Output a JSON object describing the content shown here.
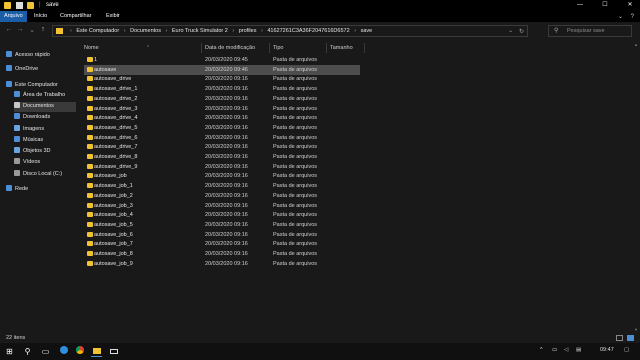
{
  "window": {
    "title": "save",
    "minimize": "—",
    "maximize": "☐",
    "close": "✕"
  },
  "ribbon": {
    "tabs": [
      {
        "label": "Arquivo",
        "active": true
      },
      {
        "label": "Início",
        "active": false
      },
      {
        "label": "Compartilhar",
        "active": false
      },
      {
        "label": "Exibir",
        "active": false
      }
    ],
    "collapse": "⌄",
    "help": "?"
  },
  "nav": {
    "back": "←",
    "forward": "→",
    "recent": "⌄",
    "up": "↑"
  },
  "address": {
    "crumbs": [
      "Este Computador",
      "Documentos",
      "Euro Truck Simulator 2",
      "profiles",
      "41627261C3A36F2047616D6572",
      "save"
    ],
    "separator": "›",
    "dropdown": "⌄",
    "refresh": "↻"
  },
  "search": {
    "placeholder": "Pesquisar save",
    "icon": "search-icon"
  },
  "sidebar": {
    "items": [
      {
        "label": "Acesso rápido",
        "icon": "star-icon",
        "color": "#4d8fd6"
      },
      {
        "label": "OneDrive",
        "icon": "cloud-icon",
        "color": "#4d8fd6"
      },
      {
        "label": "Este Computador",
        "icon": "computer-icon",
        "color": "#4d8fd6"
      },
      {
        "label": "Área de Trabalho",
        "icon": "desktop-icon",
        "color": "#4d8fd6"
      },
      {
        "label": "Documentos",
        "icon": "documents-icon",
        "color": "#c7c7c7",
        "selected": true
      },
      {
        "label": "Downloads",
        "icon": "download-icon",
        "color": "#4d8fd6"
      },
      {
        "label": "Imagens",
        "icon": "pictures-icon",
        "color": "#6aa5e0"
      },
      {
        "label": "Músicas",
        "icon": "music-icon",
        "color": "#4d8fd6"
      },
      {
        "label": "Objetos 3D",
        "icon": "cube-icon",
        "color": "#6aa5e0"
      },
      {
        "label": "Vídeos",
        "icon": "video-icon",
        "color": "#9a9a9a"
      },
      {
        "label": "Disco Local (C:)",
        "icon": "drive-icon",
        "color": "#9a9a9a"
      },
      {
        "label": "Rede",
        "icon": "network-icon",
        "color": "#4d8fd6"
      }
    ]
  },
  "columns": {
    "name": "Nome",
    "date": "Data de modificação",
    "type": "Tipo",
    "size": "Tamanho",
    "sort_indicator": "⌃"
  },
  "files": [
    {
      "name": "1",
      "date": "20/03/2020 09:45",
      "type": "Pasta de arquivos"
    },
    {
      "name": "autosave",
      "date": "20/03/2020 09:46",
      "type": "Pasta de arquivos",
      "selected": true
    },
    {
      "name": "autosave_drive",
      "date": "20/03/2020 09:16",
      "type": "Pasta de arquivos"
    },
    {
      "name": "autosave_drive_1",
      "date": "20/03/2020 09:16",
      "type": "Pasta de arquivos"
    },
    {
      "name": "autosave_drive_2",
      "date": "20/03/2020 09:16",
      "type": "Pasta de arquivos"
    },
    {
      "name": "autosave_drive_3",
      "date": "20/03/2020 09:16",
      "type": "Pasta de arquivos"
    },
    {
      "name": "autosave_drive_4",
      "date": "20/03/2020 09:16",
      "type": "Pasta de arquivos"
    },
    {
      "name": "autosave_drive_5",
      "date": "20/03/2020 09:16",
      "type": "Pasta de arquivos"
    },
    {
      "name": "autosave_drive_6",
      "date": "20/03/2020 09:16",
      "type": "Pasta de arquivos"
    },
    {
      "name": "autosave_drive_7",
      "date": "20/03/2020 09:16",
      "type": "Pasta de arquivos"
    },
    {
      "name": "autosave_drive_8",
      "date": "20/03/2020 09:16",
      "type": "Pasta de arquivos"
    },
    {
      "name": "autosave_drive_9",
      "date": "20/03/2020 09:16",
      "type": "Pasta de arquivos"
    },
    {
      "name": "autosave_job",
      "date": "20/03/2020 09:16",
      "type": "Pasta de arquivos"
    },
    {
      "name": "autosave_job_1",
      "date": "20/03/2020 09:16",
      "type": "Pasta de arquivos"
    },
    {
      "name": "autosave_job_2",
      "date": "20/03/2020 09:16",
      "type": "Pasta de arquivos"
    },
    {
      "name": "autosave_job_3",
      "date": "20/03/2020 09:16",
      "type": "Pasta de arquivos"
    },
    {
      "name": "autosave_job_4",
      "date": "20/03/2020 09:16",
      "type": "Pasta de arquivos"
    },
    {
      "name": "autosave_job_5",
      "date": "20/03/2020 09:16",
      "type": "Pasta de arquivos"
    },
    {
      "name": "autosave_job_6",
      "date": "20/03/2020 09:16",
      "type": "Pasta de arquivos"
    },
    {
      "name": "autosave_job_7",
      "date": "20/03/2020 09:16",
      "type": "Pasta de arquivos"
    },
    {
      "name": "autosave_job_8",
      "date": "20/03/2020 09:16",
      "type": "Pasta de arquivos"
    },
    {
      "name": "autosave_job_9",
      "date": "20/03/2020 09:16",
      "type": "Pasta de arquivos"
    }
  ],
  "status": {
    "count": "22 itens"
  },
  "taskbar": {
    "start": "⊞",
    "search": "⚲",
    "taskview": "▭",
    "clock": "09:47",
    "tray_up": "^"
  },
  "colors": {
    "accent": "#1a5ea8",
    "folder": "#f1c232",
    "background": "#191919",
    "selection": "#4d4d4d"
  }
}
